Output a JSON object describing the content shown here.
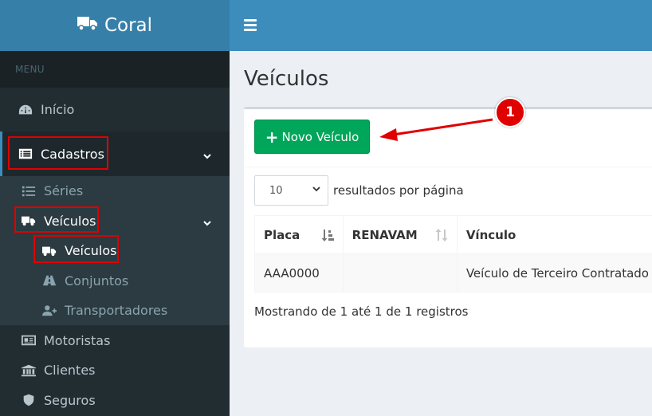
{
  "app": {
    "brand": "Coral"
  },
  "sidebar": {
    "menu_header": "MENU",
    "items": {
      "inicio": "Início",
      "cadastros": "Cadastros",
      "series": "Séries",
      "veiculos": "Veículos",
      "veiculos_sub": "Veículos",
      "conjuntos": "Conjuntos",
      "transportadores": "Transportadores",
      "motoristas": "Motoristas",
      "clientes": "Clientes",
      "seguros": "Seguros"
    }
  },
  "main": {
    "page_title": "Veículos",
    "new_button": "Novo Veículo",
    "page_length": "10",
    "page_length_suffix": "resultados por página",
    "table": {
      "headers": [
        "Placa",
        "RENAVAM",
        "Vínculo"
      ],
      "rows": [
        [
          "AAA0000",
          "",
          "Veículo de Terceiro Contratado"
        ]
      ]
    },
    "info": "Mostrando de 1 até 1 de 1 registros"
  },
  "annotation": {
    "label": "1",
    "color": "#e00000"
  },
  "colors": {
    "topbar": "#3c8dbc",
    "logo_bg": "#367fa9",
    "sidebar": "#222d32",
    "success": "#00a65a"
  }
}
